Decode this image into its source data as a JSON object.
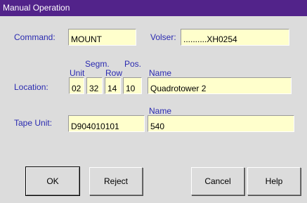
{
  "window": {
    "title": "Manual Operation"
  },
  "command": {
    "label": "Command:",
    "value": "MOUNT"
  },
  "volser": {
    "label": "Volser:",
    "value": "..........XH0254"
  },
  "location": {
    "label": "Location:",
    "headers": {
      "segm": "Segm.",
      "pos": "Pos.",
      "unit": "Unit",
      "row": "Row",
      "name": "Name"
    },
    "unit": "02",
    "segm": "32",
    "row": "14",
    "pos": "10",
    "name": "Quadrotower  2"
  },
  "tape_unit": {
    "label": "Tape Unit:",
    "name_header": "Name",
    "value": "D904010101",
    "name": "540"
  },
  "buttons": {
    "ok": "OK",
    "reject": "Reject",
    "cancel": "Cancel",
    "help": "Help"
  },
  "colors": {
    "titlebar": "#52238a",
    "label": "#2a2ab0",
    "field_bg": "#ffffcc",
    "window_bg": "#dcdcdc"
  }
}
